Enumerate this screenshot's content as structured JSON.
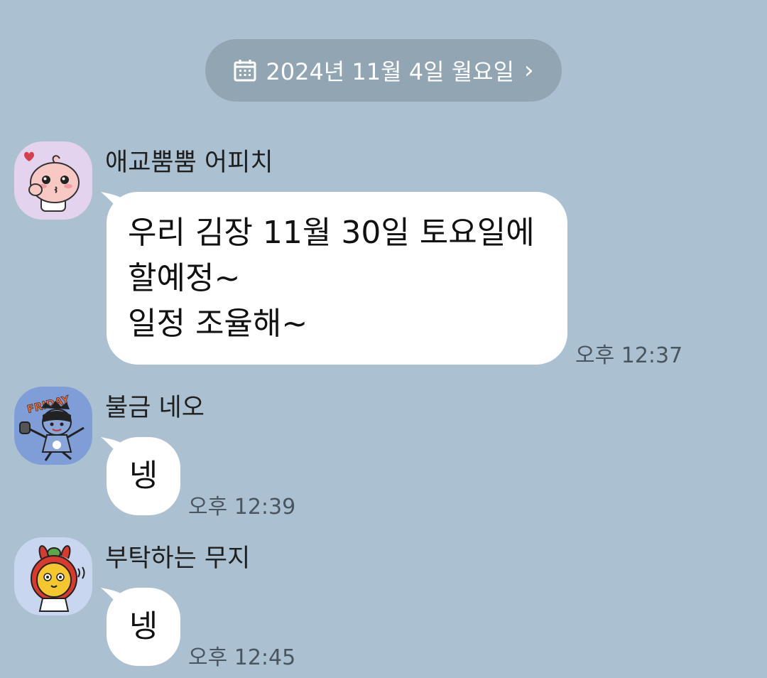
{
  "date_bar": {
    "label": "2024년 11월 4일 월요일",
    "icon": "calendar-icon",
    "chevron": "›"
  },
  "colors": {
    "background": "#abc1d1",
    "date_pill": "#91a5b3",
    "bubble": "#ffffff"
  },
  "messages": [
    {
      "sender": "애교뿜뿜 어피치",
      "avatar": "apeach-sticker-avatar",
      "text": "우리 김장 11월 30일 토요일에\n할예정~\n일정 조율해~",
      "time": "오후 12:37"
    },
    {
      "sender": "불금 네오",
      "avatar": "neo-friday-avatar",
      "text": "넹",
      "time": "오후 12:39",
      "sticker_text": "FRIDAY"
    },
    {
      "sender": "부탁하는 무지",
      "avatar": "muzi-avatar",
      "text": "넹",
      "time": "오후 12:45"
    }
  ]
}
